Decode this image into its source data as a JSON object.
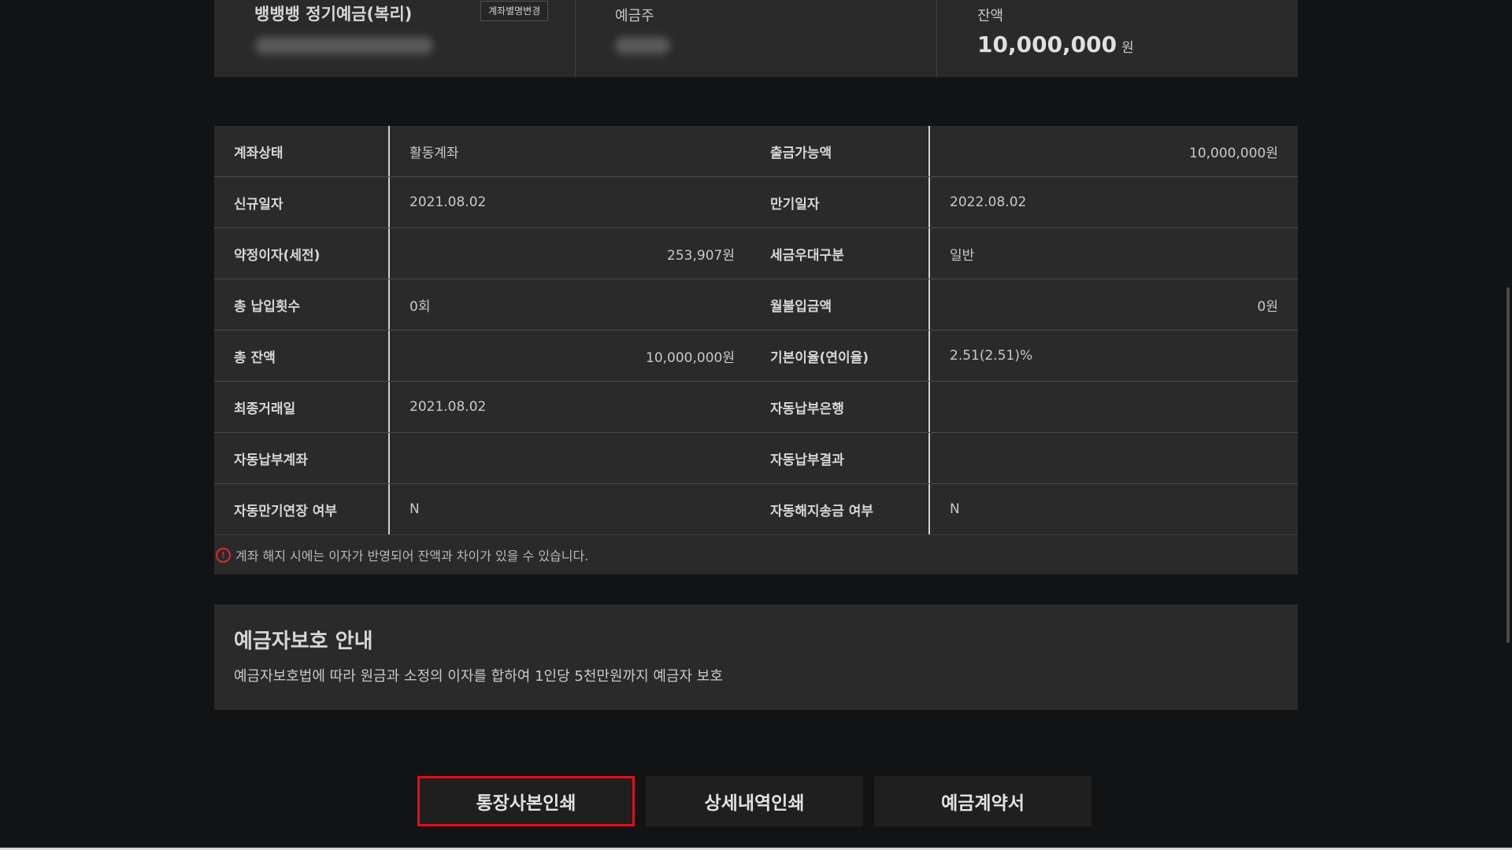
{
  "summary": {
    "account_name": "뱅뱅뱅 정기예금(복리)",
    "alias_button": "계좌별명변경",
    "depositor_label": "예금주",
    "balance_label": "잔액",
    "balance_value": "10,000,000",
    "balance_unit": "원"
  },
  "details": {
    "rows": [
      {
        "k1": "계좌상태",
        "v1": "활동계좌",
        "k2": "출금가능액",
        "v2": "10,000,000원"
      },
      {
        "k1": "신규일자",
        "v1": "2021.08.02",
        "k2": "만기일자",
        "v2": "2022.08.02"
      },
      {
        "k1": "약정이자(세전)",
        "v1": "253,907원",
        "k2": "세금우대구분",
        "v2": "일반"
      },
      {
        "k1": "총 납입횟수",
        "v1": "0회",
        "k2": "월불입금액",
        "v2": "0원"
      },
      {
        "k1": "총 잔액",
        "v1": "10,000,000원",
        "k2": "기본이율(연이율)",
        "v2": "2.51(2.51)%"
      },
      {
        "k1": "최종거래일",
        "v1": "2021.08.02",
        "k2": "자동납부은행",
        "v2": ""
      },
      {
        "k1": "자동납부계좌",
        "v1": "",
        "k2": "자동납부결과",
        "v2": ""
      },
      {
        "k1": "자동만기연장 여부",
        "v1": "N",
        "k2": "자동해지송금 여부",
        "v2": "N"
      }
    ],
    "notice_icon": "!",
    "notice": "계좌 해지 시에는 이자가 반영되어 잔액과 차이가 있을 수 있습니다."
  },
  "protection": {
    "title": "예금자보호 안내",
    "description": "예금자보호법에 따라 원금과 소정의 이자를 합하여 1인당 5천만원까지 예금자 보호"
  },
  "actions": {
    "print_passbook": "통장사본인쇄",
    "print_details": "상세내역인쇄",
    "contract": "예금계약서"
  },
  "colors": {
    "background": "#121314",
    "panel": "#2a2a2b",
    "highlight": "#e0101a",
    "notice_icon": "#e0282e"
  },
  "icons": {
    "notice": "alert-circle-icon"
  }
}
